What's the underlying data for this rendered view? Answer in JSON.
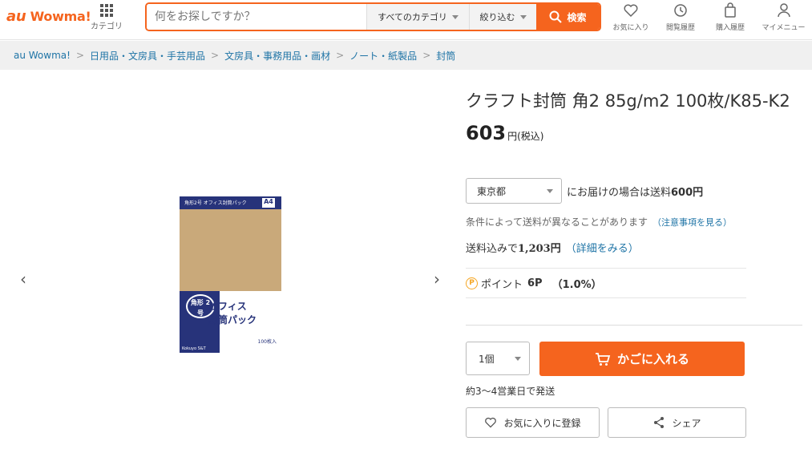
{
  "header": {
    "logo_au": "au",
    "logo_name": "Wowma!",
    "category_label": "カテゴリ",
    "search_placeholder": "何をお探しですか？",
    "category_select": "すべてのカテゴリ",
    "filter_select": "絞り込む",
    "search_button": "検索",
    "icons": [
      {
        "icon": "heart-icon",
        "label": "お気に入り"
      },
      {
        "icon": "history-icon",
        "label": "閲覧履歴"
      },
      {
        "icon": "bag-icon",
        "label": "購入履歴"
      },
      {
        "icon": "user-icon",
        "label": "マイメニュー"
      }
    ]
  },
  "breadcrumb": [
    "au Wowma!",
    "日用品・文房具・手芸用品",
    "文房具・事務用品・画材",
    "ノート・紙製品",
    "封筒"
  ],
  "product": {
    "title": "クラフト封筒 角2 85g/m2 100枚/K85-K2",
    "price": "603",
    "price_unit": "円(税込)",
    "image": {
      "top_text": "角形2号 オフィス封筒パック",
      "size": "A4",
      "badge": "角形\n2号",
      "line1": "オフィス",
      "line2": "封筒パック",
      "count": "100枚入",
      "brand": "Kokuyo S&T"
    }
  },
  "shipping": {
    "prefecture": "東京都",
    "text_prefix": "にお届けの場合は送料",
    "fee": "600円",
    "note": "条件によって送料が異なることがあります",
    "note_link": "（注意事項を見る）",
    "total_prefix": "送料込みで",
    "total": "1,203円",
    "total_link": "（詳細をみる）"
  },
  "points": {
    "icon": "P",
    "label": "ポイント",
    "value": "6P",
    "rate": "（1.0%）"
  },
  "purchase": {
    "quantity": "1個",
    "cart_button": "かごに入れる",
    "eta": "約3〜4営業日で発送",
    "favorite_button": "お気に入りに登録",
    "share_button": "シェア"
  },
  "colors": {
    "accent": "#f5641e",
    "link": "#1f74a6",
    "navy": "#27337a"
  }
}
